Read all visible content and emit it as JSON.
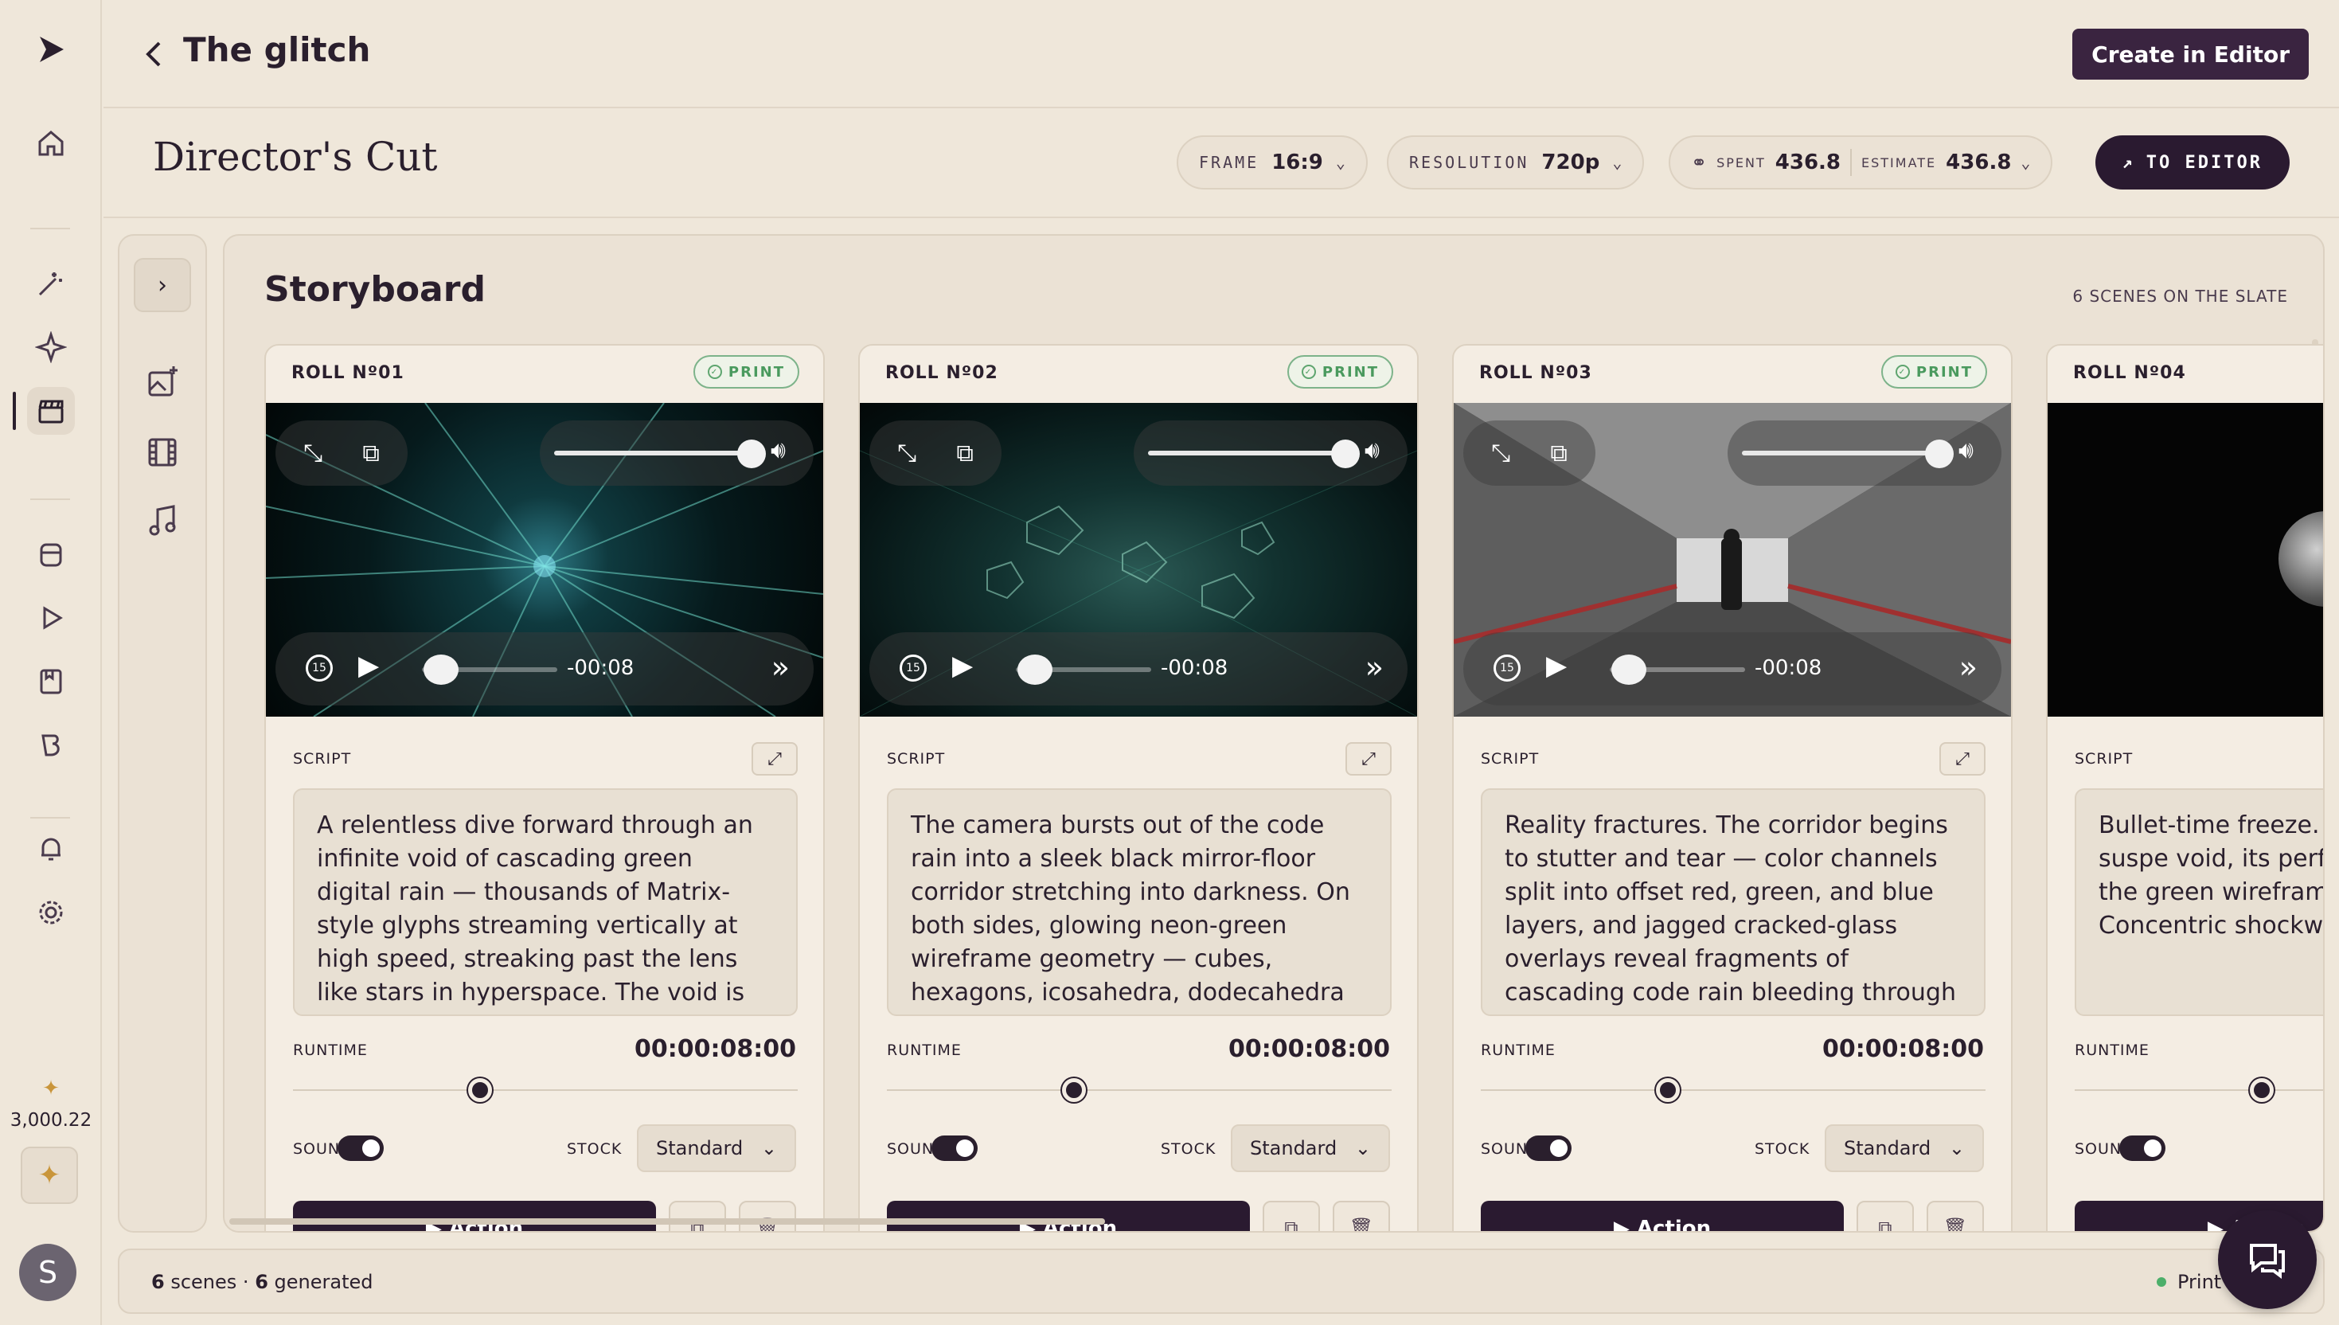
{
  "header": {
    "project_title": "The glitch",
    "create_button": "Create in Editor"
  },
  "subheader": {
    "title": "Director's Cut",
    "frame_label": "FRAME",
    "frame_value": "16:9",
    "resolution_label": "RESOLUTION",
    "resolution_value": "720p",
    "spent_label": "SPENT",
    "spent_value": "436.8",
    "estimate_label": "ESTIMATE",
    "estimate_value": "436.8",
    "editor_button": "TO EDITOR"
  },
  "sidebar": {
    "credits": "3,000.22"
  },
  "user": {
    "initial": "S"
  },
  "storyboard": {
    "title": "Storyboard",
    "scene_count": "6 SCENES ON THE SLATE"
  },
  "labels": {
    "script": "SCRIPT",
    "runtime": "RUNTIME",
    "sound": "SOUND",
    "stock": "STOCK",
    "print": "PRINT",
    "action": "Action"
  },
  "scenes": [
    {
      "roll": "ROLL Nº01",
      "printed": true,
      "time_remaining": "-00:08",
      "script": "A relentless dive forward through an infinite void of cascading green digital rain — thousands of Matrix-style glyphs streaming vertically at high speed, streaking past the lens like stars in hyperspace. The void is pure black with",
      "runtime": "00:00:08:00",
      "runtime_fraction": 0.37,
      "sound_on": true,
      "stock": "Standard"
    },
    {
      "roll": "ROLL Nº02",
      "printed": true,
      "time_remaining": "-00:08",
      "script": "The camera bursts out of the code rain into a sleek black mirror-floor corridor stretching into darkness. On both sides, glowing neon-green wireframe geometry — cubes, hexagons, icosahedra, dodecahedra — hovers and",
      "runtime": "00:00:08:00",
      "runtime_fraction": 0.37,
      "sound_on": true,
      "stock": "Standard"
    },
    {
      "roll": "ROLL Nº03",
      "printed": true,
      "time_remaining": "-00:08",
      "script": "Reality fractures. The corridor begins to stutter and tear — color channels split into offset red, green, and blue layers, and jagged cracked-glass overlays reveal fragments of cascading code rain bleeding through from another",
      "runtime": "00:00:08:00",
      "runtime_fraction": 0.37,
      "sound_on": true,
      "stock": "Standard"
    },
    {
      "roll": "ROLL Nº04",
      "printed": false,
      "time_remaining": "",
      "script": "Bullet-time freeze. A sphere hangs suspe void, its perfectly ref mirroring the green wireframe geometry Concentric shockwa",
      "runtime": "",
      "runtime_fraction": 0.37,
      "sound_on": true,
      "stock": ""
    }
  ],
  "status": {
    "scenes_num": "6",
    "scenes_word": "scenes ·",
    "generated_num": "6",
    "generated_word": "generated",
    "right_text": "Print of t"
  },
  "colors": {
    "background": "#efe7da",
    "accent": "#2a1a30",
    "print_green": "#4a9a5e",
    "credit_gold": "#c9953a"
  }
}
